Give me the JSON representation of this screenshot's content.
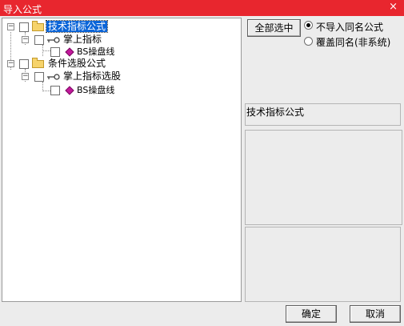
{
  "window": {
    "title": "导入公式",
    "close_glyph": "×"
  },
  "tree": {
    "nodes": [
      {
        "label": "技术指标公式",
        "toggle": "−"
      },
      {
        "label": "掌上指标",
        "toggle": "−"
      },
      {
        "label": "BS操盘线"
      },
      {
        "label": "条件选股公式",
        "toggle": "−"
      },
      {
        "label": "掌上指标选股",
        "toggle": "−"
      },
      {
        "label": "BS操盘线"
      }
    ]
  },
  "options": {
    "select_all_label": "全部选中",
    "radio_skip_label": "不导入同名公式",
    "radio_overwrite_label": "覆盖同名(非系统)",
    "selected": "skip"
  },
  "detail": {
    "name": "技术指标公式"
  },
  "footer": {
    "ok_label": "确定",
    "cancel_label": "取消"
  }
}
